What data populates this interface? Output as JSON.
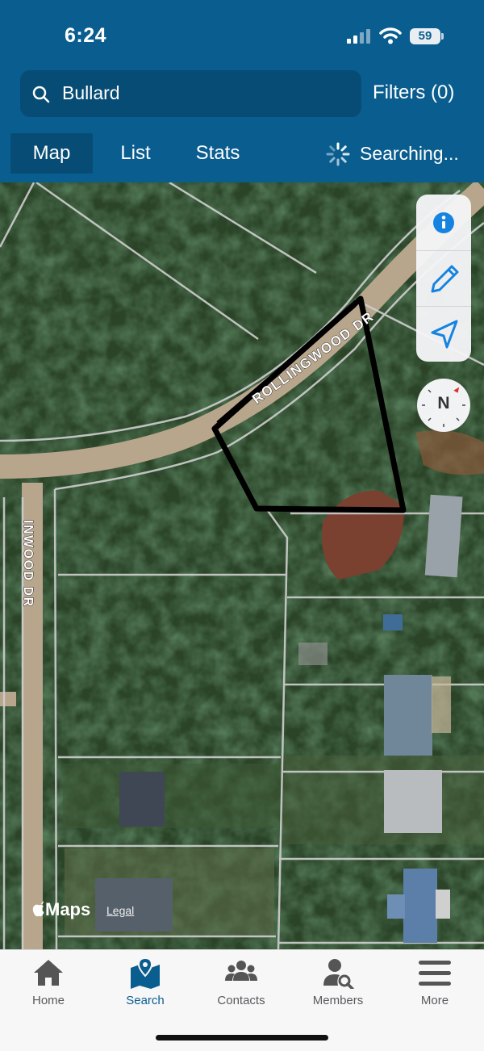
{
  "status_bar": {
    "time": "6:24",
    "battery": "59",
    "icons": [
      "signal-icon",
      "wifi-icon",
      "battery-icon"
    ]
  },
  "search": {
    "value": "Bullard",
    "icon": "search-icon",
    "filters_label": "Filters (0)"
  },
  "view_tabs": {
    "map": "Map",
    "list": "List",
    "stats": "Stats",
    "status": "Searching..."
  },
  "map": {
    "street_labels": [
      "ROLLINGWOOD DR",
      "INWOOD DR"
    ],
    "controls": [
      "info-icon",
      "pencil-icon",
      "location-arrow-icon"
    ],
    "compass": "N",
    "attribution_logo": "Maps",
    "attribution_legal": "Legal"
  },
  "bottom_nav": {
    "items": [
      {
        "label": "Home",
        "icon": "home-icon"
      },
      {
        "label": "Search",
        "icon": "map-pin-icon",
        "active": true
      },
      {
        "label": "Contacts",
        "icon": "contacts-icon"
      },
      {
        "label": "Members",
        "icon": "member-search-icon"
      },
      {
        "label": "More",
        "icon": "hamburger-icon"
      }
    ]
  },
  "colors": {
    "header": "#0a5d8f",
    "header_field": "#074c75",
    "accent": "#0a5d8f",
    "control_blue": "#1683e0",
    "tab_inactive": "#5a5a5e"
  }
}
